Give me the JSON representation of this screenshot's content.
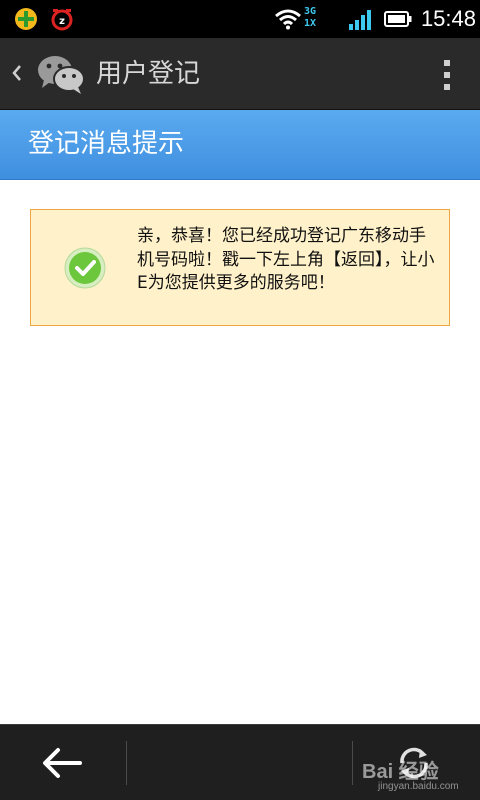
{
  "status_bar": {
    "time": "15:48",
    "network_top": "3G",
    "network_bottom": "1X",
    "icons": [
      "app-plus-icon",
      "alarm-z-icon",
      "wifi-icon",
      "signal-icon",
      "battery-icon"
    ]
  },
  "app_bar": {
    "title": "用户登记",
    "icons": [
      "back-chevron-icon",
      "wechat-logo-icon",
      "overflow-menu-icon"
    ]
  },
  "message_header": {
    "title": "登记消息提示"
  },
  "notice": {
    "text": "亲，恭喜！您已经成功登记广东移动手机号码啦！戳一下左上角【返回】，让小E为您提供更多的服务吧！",
    "icon": "check-icon"
  },
  "bottom_bar": {
    "icons": [
      "back-arrow-icon",
      "refresh-icon"
    ]
  },
  "watermark": {
    "brand": "Bai 经验",
    "url": "jingyan.baidu.com"
  },
  "colors": {
    "status_bar": "#000000",
    "app_bar": "#2a2a2a",
    "header_blue": "#4a9be8",
    "notice_bg": "#fff1c9",
    "notice_border": "#f0a640",
    "check_green": "#6cc73c",
    "bottom_bar": "#1f1f1f"
  }
}
